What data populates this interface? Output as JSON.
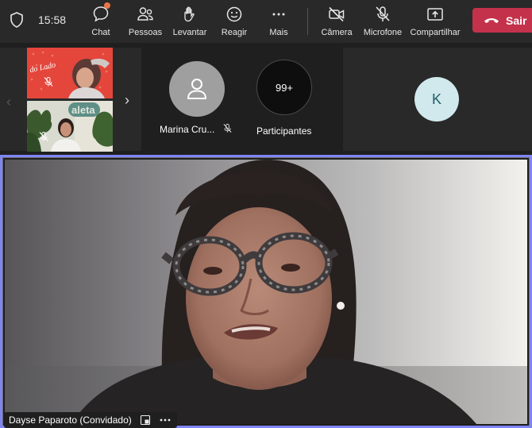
{
  "meeting": {
    "time": "15:58",
    "toolbar": {
      "chat": "Chat",
      "people": "Pessoas",
      "raise": "Levantar",
      "react": "Reagir",
      "more": "Mais",
      "camera": "Câmera",
      "mic": "Microfone",
      "share": "Compartilhar",
      "leave": "Sair"
    },
    "colors": {
      "leave": "#c4314b",
      "active_border": "#7f85f5",
      "badge": "#e97548"
    }
  },
  "gallery": {
    "tiles": [
      {
        "name": "Marina Cru...",
        "avatar": "person-icon",
        "muted": true
      },
      {
        "count": "99+",
        "label": "Participantes"
      },
      {
        "initial": "K"
      }
    ]
  },
  "speaker": {
    "name": "Dayse Paparoto (Convidado)"
  }
}
